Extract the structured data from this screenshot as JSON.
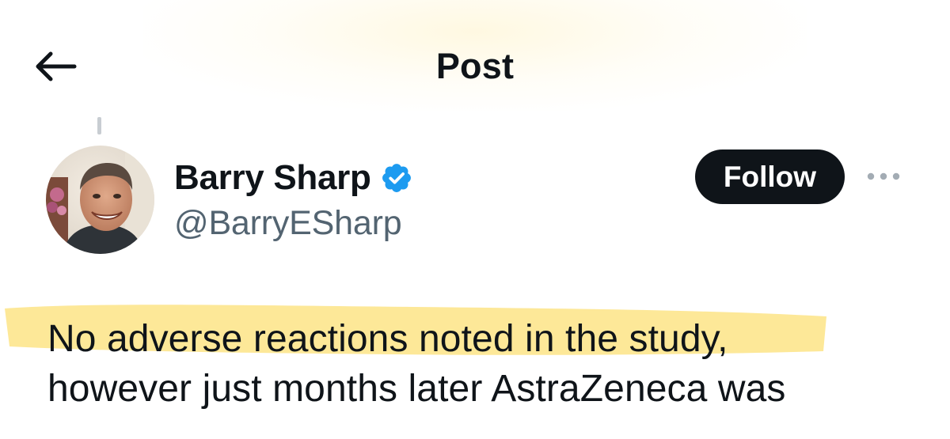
{
  "header": {
    "title": "Post",
    "back_icon": "arrow-left-icon"
  },
  "author": {
    "display_name": "Barry Sharp",
    "handle": "@BarryESharp",
    "verified": true,
    "verified_color": "#1d9bf0",
    "avatar": "profile-photo"
  },
  "actions": {
    "follow_label": "Follow",
    "more_icon": "more-horizontal-icon"
  },
  "post": {
    "lines": [
      "No adverse reactions noted in the study,",
      "however just months later AstraZeneca was"
    ],
    "highlight_color": "#fde58a"
  },
  "colors": {
    "text_primary": "#0f1419",
    "text_secondary": "#536471",
    "follow_bg": "#0f1419",
    "follow_text": "#ffffff"
  }
}
